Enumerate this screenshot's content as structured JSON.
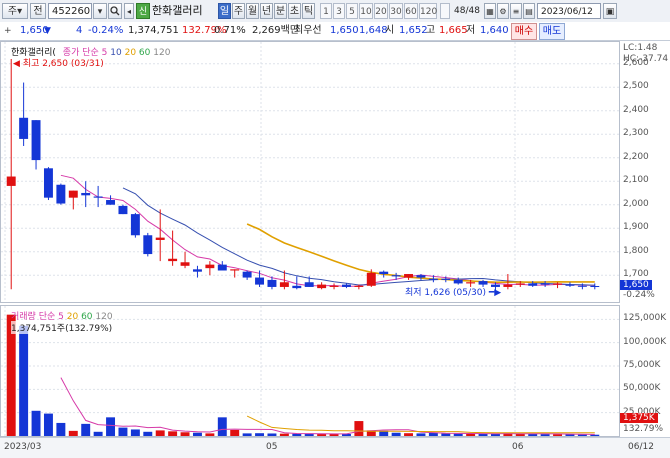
{
  "toolbar": {
    "market_label": "주",
    "market_arrow": "▾",
    "search_label": "전",
    "code": "452260",
    "name": "한화갤러리",
    "period_buttons": [
      "일",
      "주",
      "월",
      "년",
      "분",
      "초",
      "틱"
    ],
    "selected_period": "일",
    "interval_buttons": [
      "1",
      "3",
      "5",
      "10",
      "20",
      "30",
      "60",
      "120"
    ],
    "page_counter": "48/48",
    "date": "2023/06/12"
  },
  "info": {
    "price": "1,650",
    "change_arrow": "▼",
    "change": "4",
    "change_pct": "-0.24%",
    "volume": "1,374,751",
    "volume_pct": "132.79%",
    "turnover_pct": "0.71%",
    "amount": "2,269백만",
    "stock_type": "최우선",
    "bid1": "1,650",
    "bid2": "1,648",
    "open_label": "시",
    "open": "1,652",
    "high_label": "고",
    "high": "1,665",
    "low_label": "저",
    "low": "1,640",
    "sell_label": "매수",
    "buy_label": "매도"
  },
  "price_pane": {
    "title": "한화갤러리(",
    "legend_prefix": "종가 단순",
    "ma_labels": [
      "5",
      "10",
      "20",
      "60",
      "120"
    ],
    "ma_colors": [
      "#d63aa8",
      "#3750b0",
      "#e0a000",
      "#2ea64a",
      "#888888"
    ],
    "max_annotation": "최고 2,650 (03/31)",
    "min_annotation": "최저 1,626 (05/30)",
    "lc_label": "LC:1.48",
    "hc_label": "HC:-37.74",
    "current_price_tag": "1,650",
    "current_pct_tag": "-0.24%",
    "y_ticks": [
      "2,600",
      "2,500",
      "2,400",
      "2,300",
      "2,200",
      "2,100",
      "2,000",
      "1,900",
      "1,800",
      "1,700"
    ]
  },
  "volume_pane": {
    "legend_prefix": "거래량 단순",
    "ma_labels": [
      "5",
      "20",
      "60",
      "120"
    ],
    "ma_colors": [
      "#d63aa8",
      "#e0a000",
      "#2ea64a",
      "#888888"
    ],
    "annotation": "1,374,751주(132.79%)",
    "current_tag": "1,375K",
    "current_pct_tag": "132.79%",
    "y_ticks": [
      "125,000K",
      "100,000K",
      "75,000K",
      "50,000K",
      "25,000K"
    ]
  },
  "x_axis": {
    "labels": [
      "2023/03",
      "05",
      "06",
      "06/12"
    ]
  },
  "colors": {
    "up": "#e01010",
    "down": "#1436d6",
    "ma5": "#d63aa8",
    "ma10": "#3750b0",
    "ma20": "#e0a000"
  },
  "chart_data": {
    "type": "candlestick",
    "dates": [
      "03/31",
      "04/03",
      "04/04",
      "04/05",
      "04/06",
      "04/07",
      "04/10",
      "04/11",
      "04/12",
      "04/13",
      "04/14",
      "04/17",
      "04/18",
      "04/19",
      "04/20",
      "04/21",
      "04/24",
      "04/25",
      "04/26",
      "04/27",
      "04/28",
      "05/02",
      "05/03",
      "05/04",
      "05/08",
      "05/09",
      "05/10",
      "05/11",
      "05/12",
      "05/15",
      "05/16",
      "05/17",
      "05/18",
      "05/19",
      "05/22",
      "05/23",
      "05/24",
      "05/25",
      "05/26",
      "05/30",
      "05/31",
      "06/01",
      "06/02",
      "06/05",
      "06/07",
      "06/08",
      "06/09",
      "06/12"
    ],
    "open": [
      2080,
      2370,
      2360,
      2155,
      2085,
      2030,
      2050,
      2035,
      2020,
      1995,
      1960,
      1870,
      1850,
      1760,
      1740,
      1725,
      1730,
      1745,
      1720,
      1715,
      1690,
      1680,
      1650,
      1655,
      1670,
      1645,
      1650,
      1660,
      1650,
      1655,
      1715,
      1700,
      1690,
      1700,
      1685,
      1685,
      1680,
      1665,
      1675,
      1660,
      1650,
      1660,
      1665,
      1665,
      1660,
      1660,
      1655,
      1654
    ],
    "high": [
      2620,
      2520,
      2360,
      2160,
      2090,
      2060,
      2100,
      2080,
      2040,
      2000,
      1965,
      1880,
      1980,
      1890,
      1800,
      1740,
      1760,
      1760,
      1725,
      1720,
      1720,
      1695,
      1720,
      1695,
      1695,
      1670,
      1665,
      1665,
      1660,
      1725,
      1720,
      1710,
      1705,
      1705,
      1700,
      1695,
      1690,
      1680,
      1680,
      1670,
      1705,
      1675,
      1675,
      1675,
      1670,
      1670,
      1665,
      1665
    ],
    "low": [
      1640,
      2250,
      2150,
      2020,
      2000,
      1980,
      1990,
      1990,
      2000,
      1960,
      1860,
      1780,
      1760,
      1740,
      1730,
      1690,
      1700,
      1720,
      1690,
      1680,
      1650,
      1640,
      1640,
      1640,
      1650,
      1640,
      1640,
      1645,
      1640,
      1650,
      1690,
      1680,
      1680,
      1680,
      1670,
      1670,
      1660,
      1650,
      1650,
      1626,
      1640,
      1650,
      1650,
      1650,
      1645,
      1650,
      1640,
      1640
    ],
    "close": [
      2120,
      2280,
      2190,
      2030,
      2005,
      2060,
      2040,
      2030,
      2000,
      1960,
      1870,
      1790,
      1860,
      1770,
      1755,
      1715,
      1745,
      1720,
      1725,
      1690,
      1660,
      1650,
      1670,
      1645,
      1650,
      1660,
      1655,
      1650,
      1655,
      1710,
      1705,
      1695,
      1705,
      1690,
      1680,
      1680,
      1665,
      1670,
      1660,
      1650,
      1660,
      1665,
      1655,
      1660,
      1665,
      1655,
      1654,
      1650
    ],
    "volume": [
      130000,
      118000,
      27000,
      24000,
      14000,
      5500,
      13000,
      4500,
      20000,
      9000,
      7000,
      4500,
      6000,
      5000,
      4000,
      3500,
      2800,
      20000,
      6500,
      2800,
      3000,
      2700,
      2500,
      2400,
      2200,
      2100,
      2300,
      2200,
      16000,
      6000,
      5500,
      3500,
      3000,
      2800,
      3200,
      2600,
      2500,
      2400,
      2300,
      2500,
      3000,
      2200,
      2100,
      2000,
      1900,
      1800,
      1500,
      1375
    ],
    "y_range": [
      1620,
      2650
    ],
    "volume_range": [
      0,
      135000
    ],
    "volume_unit": "K"
  }
}
